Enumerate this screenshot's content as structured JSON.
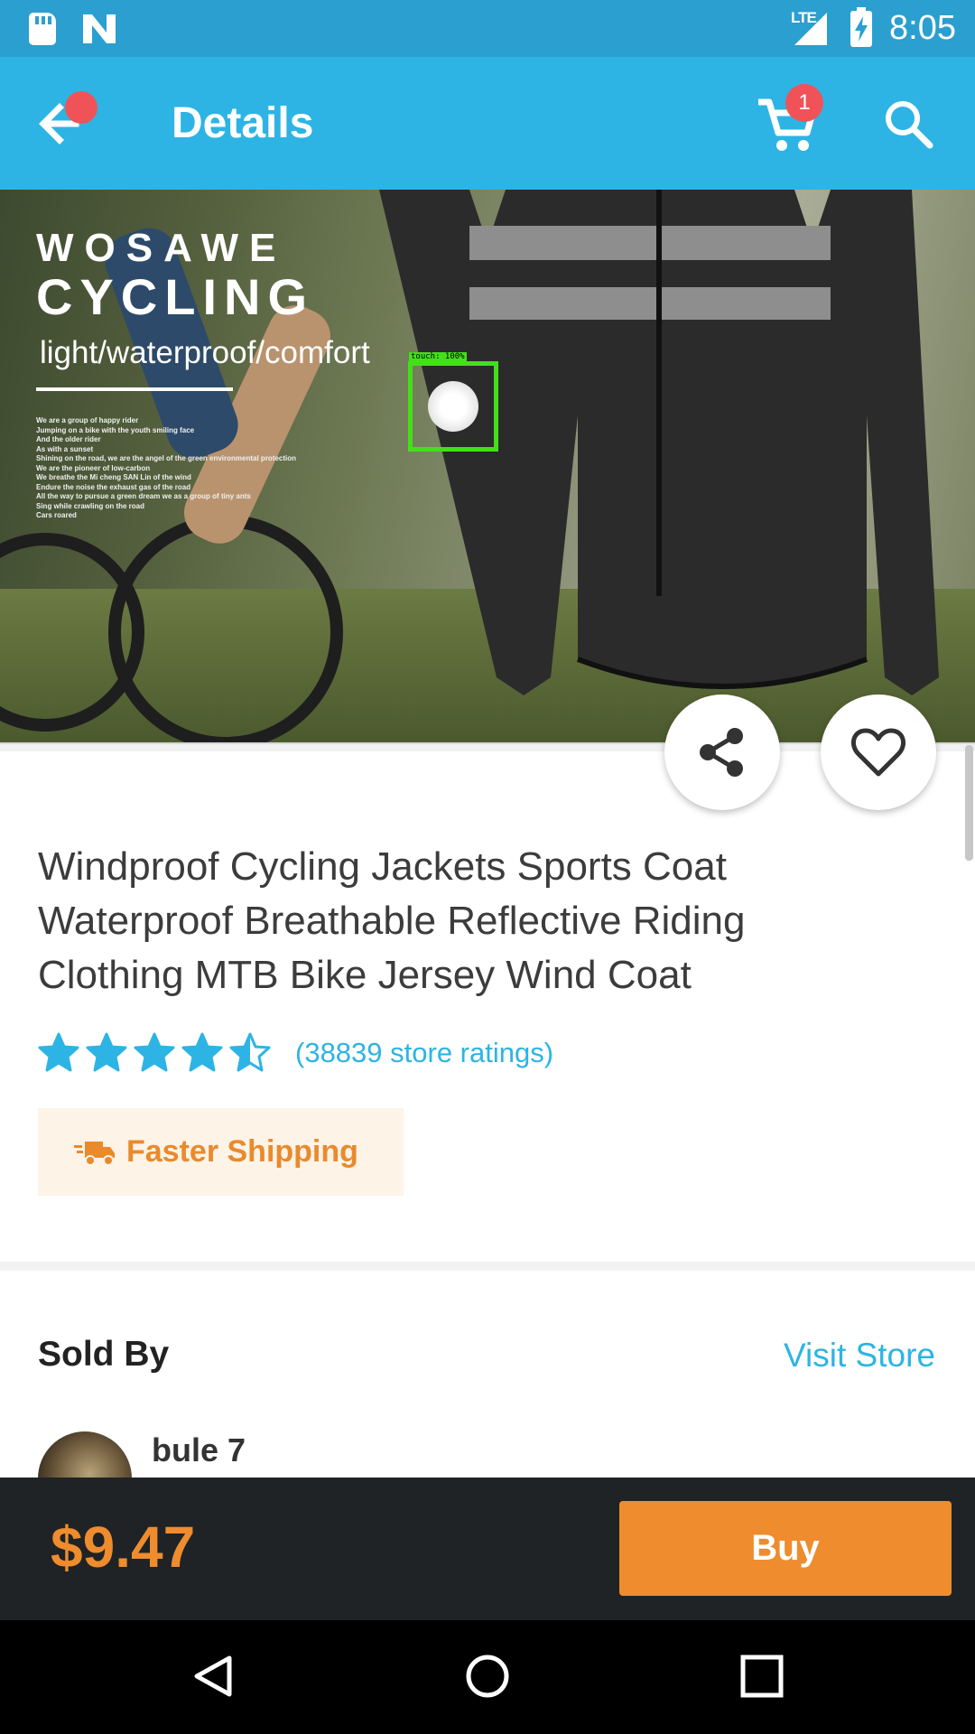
{
  "status_bar": {
    "network": "LTE",
    "time": "8:05"
  },
  "app_bar": {
    "title": "Details",
    "cart_count": "1"
  },
  "hero": {
    "brand_line1": "WOSAWE",
    "brand_line2": "CYCLING",
    "tagline": "light/waterproof/comfort",
    "poem": [
      "We are a group of happy rider",
      "Jumping on a bike with the youth smiling face",
      "And the older rider",
      "As with a sunset",
      "Shining on the road, we are the angel of the green environmental protection",
      "We are the pioneer of low-carbon",
      "We breathe the Mi cheng SAN Lin of the wind",
      "Endure the noise the exhaust gas of the road",
      "All the way to pursue a green dream we as a group of tiny ants",
      "Sing while crawling on the road",
      "Cars roared"
    ],
    "touch_label": "touch: 100%"
  },
  "product": {
    "title": "Windproof Cycling Jackets Sports Coat Waterproof Breathable Reflective Riding Clothing MTB Bike Jersey Wind Coat",
    "rating_value": 4.5,
    "rating_max": 5,
    "rating_text": "(38839 store ratings)",
    "shipping_label": "Faster Shipping"
  },
  "seller": {
    "section_title": "Sold By",
    "visit_label": "Visit Store",
    "name": "bule 7"
  },
  "buy_bar": {
    "price": "$9.47",
    "buy_label": "Buy"
  },
  "colors": {
    "accent_blue": "#2db4e4",
    "accent_orange": "#ee8c2e",
    "badge_red": "#ef5357",
    "touch_green": "#43e019"
  }
}
